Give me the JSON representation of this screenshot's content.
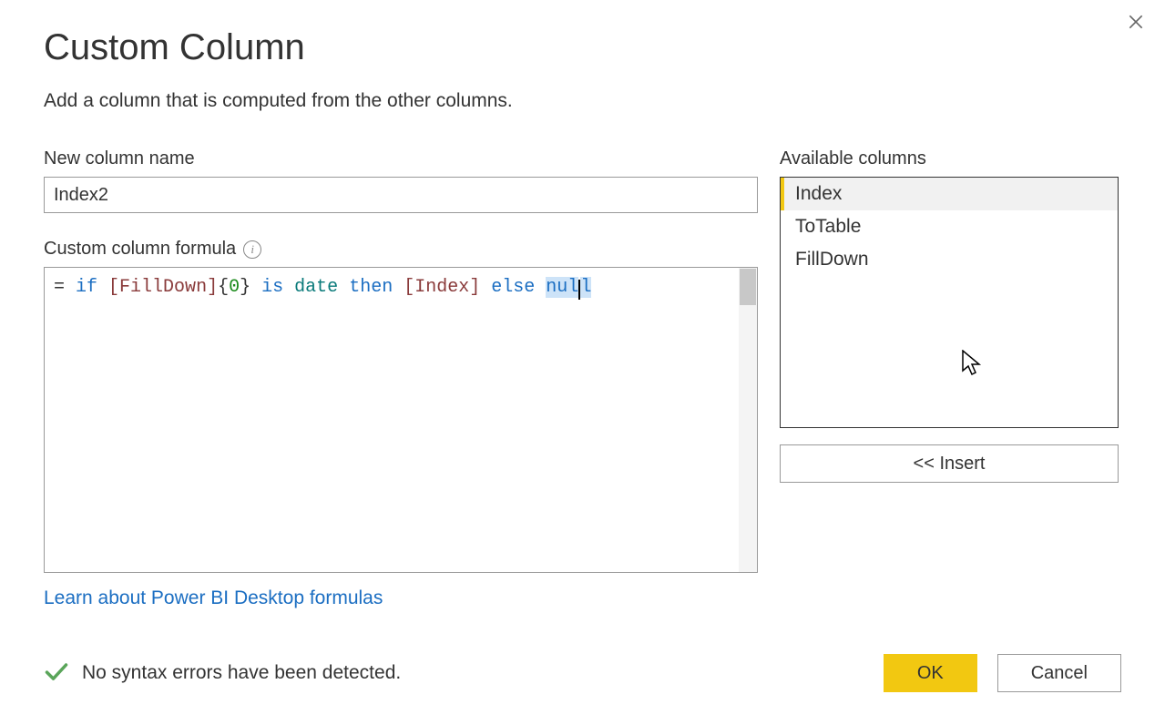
{
  "dialog": {
    "title": "Custom Column",
    "description": "Add a column that is computed from the other columns."
  },
  "fields": {
    "name_label": "New column name",
    "name_value": "Index2",
    "formula_label": "Custom column formula",
    "formula_tokens": {
      "t0": "= ",
      "t1": "if",
      "t2": " ",
      "t3": "[FillDown]",
      "t4": "{",
      "t5": "0",
      "t6": "}",
      "t7": " ",
      "t8": "is",
      "t9": " ",
      "t10": "date",
      "t11": " ",
      "t12": "then",
      "t13": " ",
      "t14": "[Index]",
      "t15": " ",
      "t16": "else",
      "t17": " ",
      "t18": "nul",
      "t19": "l"
    }
  },
  "available": {
    "label": "Available columns",
    "items": [
      {
        "label": "Index"
      },
      {
        "label": "ToTable"
      },
      {
        "label": "FillDown"
      }
    ],
    "insert_label": "<< Insert"
  },
  "link": {
    "learn": "Learn about Power BI Desktop formulas"
  },
  "status": {
    "text": "No syntax errors have been detected."
  },
  "actions": {
    "ok": "OK",
    "cancel": "Cancel"
  }
}
